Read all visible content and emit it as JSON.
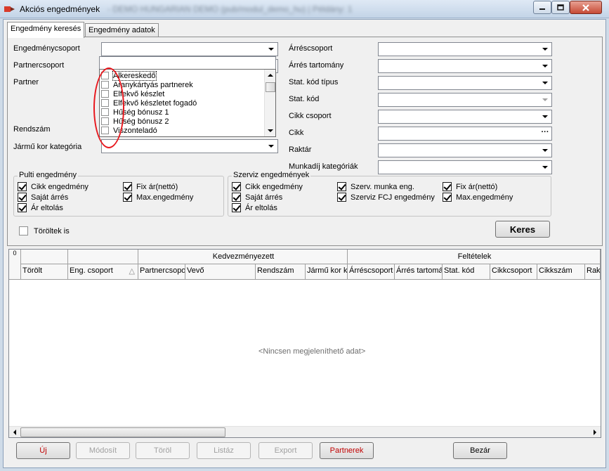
{
  "window": {
    "title": "Akciós engedmények",
    "subtitle": "- DEMO HUNGARIAN DEMO (pub/modul_demo_hu) | Példány: 1",
    "accent_color": "#c3d4e7",
    "close_color": "#c64a35"
  },
  "tabs": [
    {
      "label": "Engedmény keresés",
      "active": true
    },
    {
      "label": "Engedmény adatok",
      "active": false
    }
  ],
  "form_left": {
    "discount_group_label": "Engedménycsoport",
    "partner_group_label": "Partnercsoport",
    "partner_label": "Partner",
    "plate_label": "Rendszám",
    "vehicle_age_label": "Jármű kor kategória"
  },
  "partner_list": {
    "items": [
      "Alkereskedő",
      "Aranykártyás partnerek",
      "Elfekvő készlet",
      "Elfekvő készletet fogadó",
      "Hűség bónusz 1",
      "Hűség bónusz 2",
      "Viszonteladó"
    ],
    "highlight_color": "#e8181e"
  },
  "form_right": {
    "margin_group_label": "Árréscsoport",
    "margin_range_label": "Árrés tartomány",
    "stat_code_type_label": "Stat. kód típus",
    "stat_code_label": "Stat. kód",
    "item_group_label": "Cikk csoport",
    "item_label": "Cikk",
    "warehouse_label": "Raktár",
    "labor_categories_label": "Munkadíj kategóriák"
  },
  "counter_group": {
    "title": "Pulti engedmény",
    "options": [
      {
        "label": "Cikk engedmény",
        "checked": true
      },
      {
        "label": "Saját árrés",
        "checked": true
      },
      {
        "label": "Ár eltolás",
        "checked": true
      },
      {
        "label": "Fix ár(nettó)",
        "checked": true
      },
      {
        "label": "Max.engedmény",
        "checked": true
      }
    ]
  },
  "service_group": {
    "title": "Szerviz  engedmények",
    "options": [
      {
        "label": "Cikk engedmény",
        "checked": true
      },
      {
        "label": "Saját árrés",
        "checked": true
      },
      {
        "label": "Ár eltolás",
        "checked": true
      },
      {
        "label": "Szerv. munka eng.",
        "checked": true
      },
      {
        "label": "Szerviz FCJ engedmény",
        "checked": true
      },
      {
        "label": "Fix ár(nettó)",
        "checked": true
      },
      {
        "label": "Max.engedmény",
        "checked": true
      }
    ]
  },
  "deleted_too": {
    "label": "Töröltek is",
    "checked": false
  },
  "search_button": "Keres",
  "grid": {
    "row_indicator": "0",
    "band_headers": [
      "Kedvezményezett",
      "Feltételek"
    ],
    "columns": [
      "Törölt",
      "Eng. csoport",
      "Partnercsoport",
      "Vevő",
      "Rendszám",
      "Jármű kor kategória",
      "Árréscsoport",
      "Árrés tartomány",
      "Stat. kód",
      "Cikkcsoport",
      "Cikkszám",
      "Raktár"
    ],
    "sort_indicator": "△",
    "empty_text": "<Nincsen megjeleníthető adat>"
  },
  "footer": {
    "new": "Új",
    "modify": "Módosít",
    "delete": "Töröl",
    "list": "Listáz",
    "export": "Export",
    "partners": "Partnerek",
    "close": "Bezár"
  }
}
